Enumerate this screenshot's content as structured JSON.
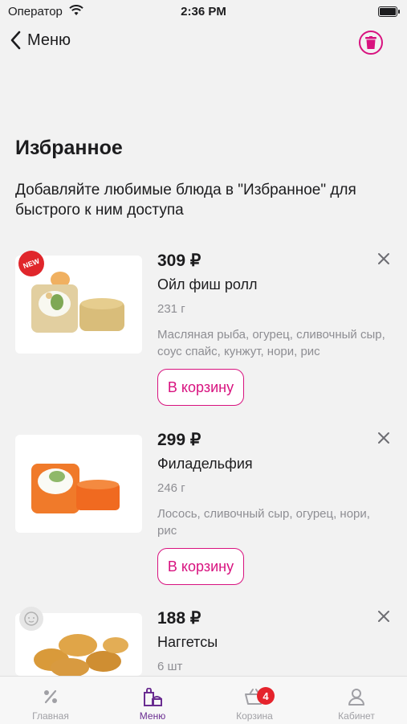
{
  "status_bar": {
    "carrier": "Оператор",
    "time": "2:36 PM"
  },
  "nav": {
    "back_label": "Меню"
  },
  "page": {
    "title": "Избранное",
    "subtitle": "Добавляйте любимые блюда в \"Избранное\" для быстрого к ним доступа"
  },
  "items": [
    {
      "price": "309 ₽",
      "name": "Ойл фиш ролл",
      "weight": "231 г",
      "description": "Масляная рыба, огурец, сливочный сыр, соус спайс, кунжут, нори, рис",
      "cart_label": "В корзину",
      "badge": "NEW"
    },
    {
      "price": "299 ₽",
      "name": "Филадельфия",
      "weight": "246 г",
      "description": "Лосось, сливочный сыр, огурец, нори, рис",
      "cart_label": "В корзину"
    },
    {
      "price": "188 ₽",
      "name": "Наггетсы",
      "weight": "6 шт"
    }
  ],
  "tabs": [
    {
      "label": "Главная",
      "icon": "percent-icon",
      "active": false
    },
    {
      "label": "Меню",
      "icon": "menu-bag-icon",
      "active": true
    },
    {
      "label": "Корзина",
      "icon": "basket-icon",
      "active": false,
      "badge": "4"
    },
    {
      "label": "Кабинет",
      "icon": "user-icon",
      "active": false
    }
  ],
  "colors": {
    "accent": "#d8127f",
    "tab_active": "#6a2d91",
    "badge": "#e5232c",
    "background": "#f2f2f2"
  }
}
